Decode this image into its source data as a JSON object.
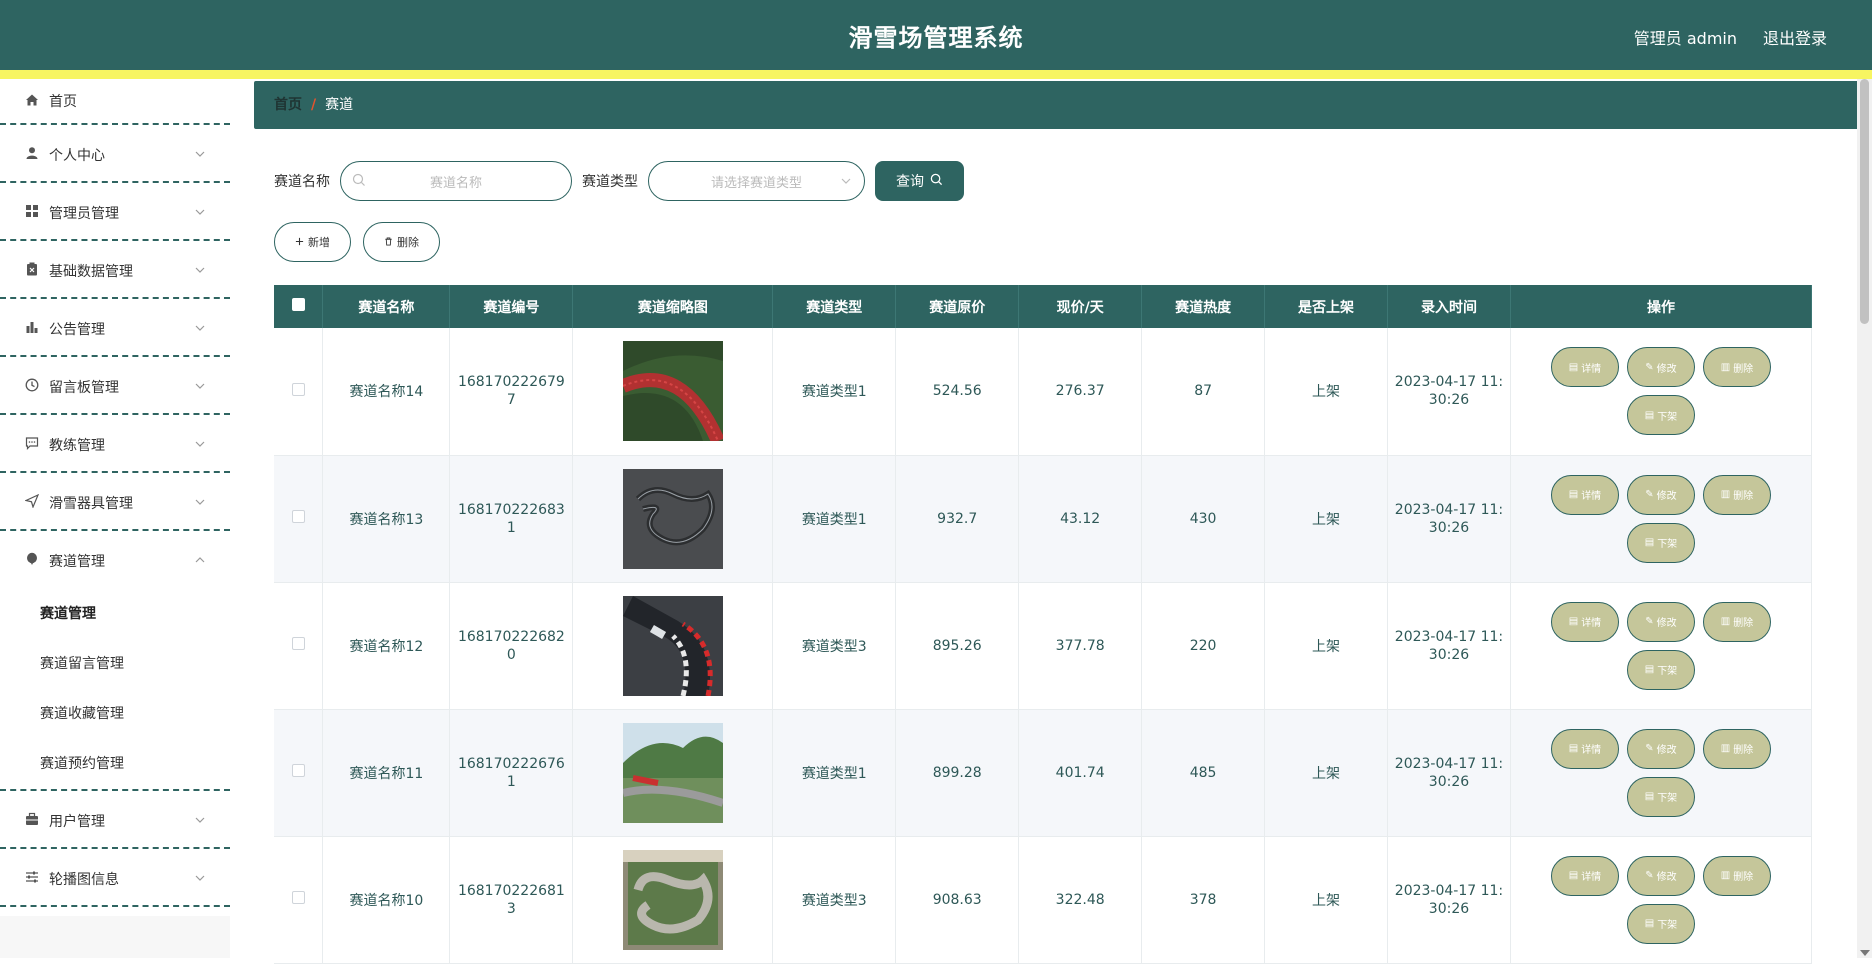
{
  "header": {
    "title": "滑雪场管理系统",
    "user": "管理员 admin",
    "logout": "退出登录"
  },
  "sidebar": {
    "items": [
      {
        "label": "首页",
        "icon": "home-icon"
      },
      {
        "label": "个人中心",
        "icon": "user-icon"
      },
      {
        "label": "管理员管理",
        "icon": "grid-icon"
      },
      {
        "label": "基础数据管理",
        "icon": "clipboard-icon"
      },
      {
        "label": "公告管理",
        "icon": "bar-chart-icon"
      },
      {
        "label": "留言板管理",
        "icon": "clock-icon"
      },
      {
        "label": "教练管理",
        "icon": "chat-icon"
      },
      {
        "label": "滑雪器具管理",
        "icon": "send-icon"
      },
      {
        "label": "赛道管理",
        "icon": "balloon-icon",
        "expanded": true
      },
      {
        "label": "用户管理",
        "icon": "briefcase-icon"
      },
      {
        "label": "轮播图信息",
        "icon": "sliders-icon"
      }
    ],
    "submenu": [
      "赛道管理",
      "赛道留言管理",
      "赛道收藏管理",
      "赛道预约管理"
    ]
  },
  "breadcrumb": {
    "home": "首页",
    "sep": "/",
    "current": "赛道"
  },
  "search": {
    "name_label": "赛道名称",
    "name_placeholder": "赛道名称",
    "type_label": "赛道类型",
    "type_placeholder": "请选择赛道类型",
    "query_label": "查询"
  },
  "actions": {
    "add": "新增",
    "delete": "删除"
  },
  "table": {
    "headers": [
      "赛道名称",
      "赛道编号",
      "赛道缩略图",
      "赛道类型",
      "赛道原价",
      "现价/天",
      "赛道热度",
      "是否上架",
      "录入时间",
      "操作"
    ],
    "ops": {
      "detail": "详情",
      "edit": "修改",
      "delete": "删除",
      "offshelf": "下架"
    },
    "rows": [
      {
        "name": "赛道名称14",
        "code1": "168170222679",
        "code2": "7",
        "type": "赛道类型1",
        "price": "524.56",
        "now": "276.37",
        "heat": "87",
        "shelf": "上架",
        "time1": "2023-04-17 11:",
        "time2": "30:26"
      },
      {
        "name": "赛道名称13",
        "code1": "168170222683",
        "code2": "1",
        "type": "赛道类型1",
        "price": "932.7",
        "now": "43.12",
        "heat": "430",
        "shelf": "上架",
        "time1": "2023-04-17 11:",
        "time2": "30:26"
      },
      {
        "name": "赛道名称12",
        "code1": "168170222682",
        "code2": "0",
        "type": "赛道类型3",
        "price": "895.26",
        "now": "377.78",
        "heat": "220",
        "shelf": "上架",
        "time1": "2023-04-17 11:",
        "time2": "30:26"
      },
      {
        "name": "赛道名称11",
        "code1": "168170222676",
        "code2": "1",
        "type": "赛道类型1",
        "price": "899.28",
        "now": "401.74",
        "heat": "485",
        "shelf": "上架",
        "time1": "2023-04-17 11:",
        "time2": "30:26"
      },
      {
        "name": "赛道名称10",
        "code1": "168170222681",
        "code2": "3",
        "type": "赛道类型3",
        "price": "908.63",
        "now": "322.48",
        "heat": "378",
        "shelf": "上架",
        "time1": "2023-04-17 11:",
        "time2": "30:26"
      }
    ]
  },
  "colors": {
    "primary": "#2e6461",
    "accent_yellow": "#f7f561",
    "op_button": "#c5c69a",
    "breadcrumb_sep": "#e4532d"
  }
}
